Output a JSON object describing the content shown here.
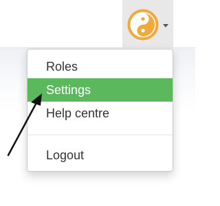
{
  "navbar": {
    "avatar_icon": "yin-yang-icon",
    "avatar_color": "#f2a93b",
    "accent_active": "#5cb85c"
  },
  "menu": {
    "items": [
      {
        "label": "Roles"
      },
      {
        "label": "Settings",
        "active": true
      },
      {
        "label": "Help centre"
      }
    ],
    "logout_label": "Logout"
  }
}
